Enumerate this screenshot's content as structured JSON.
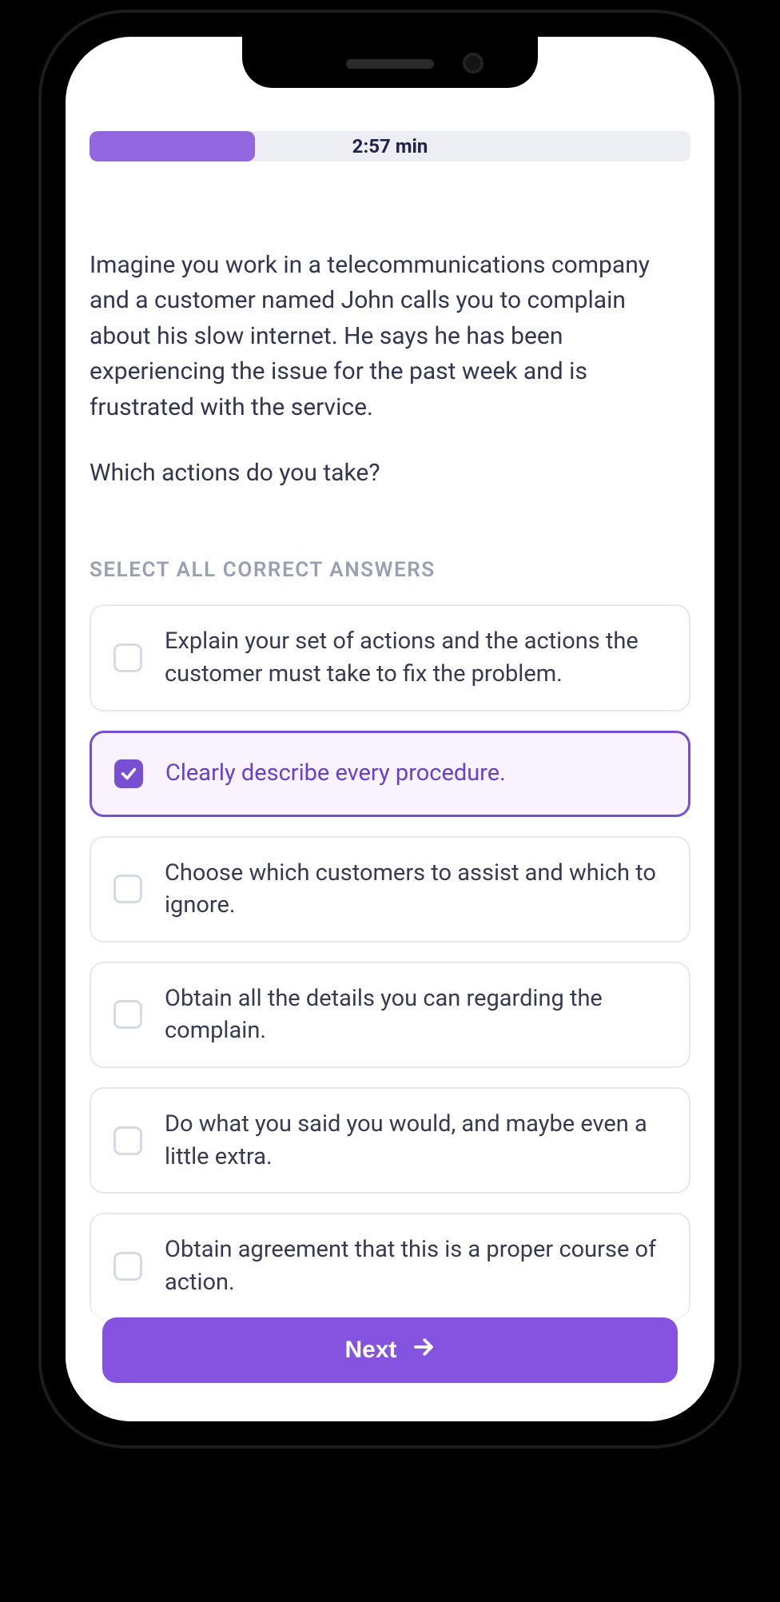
{
  "progress": {
    "percent": 27.5,
    "timer_label": "2:57 min"
  },
  "question": {
    "scenario": "Imagine you work in a telecommunications company and a customer named John calls you to complain about his slow internet. He says he has been experiencing the issue for the past week and is frustrated with the service.",
    "prompt": "Which actions do you take?"
  },
  "instructions": "SELECT ALL CORRECT ANSWERS",
  "options": [
    {
      "text": "Explain your set of actions and the actions the customer must take to fix the problem.",
      "selected": false
    },
    {
      "text": "Clearly describe every procedure.",
      "selected": true
    },
    {
      "text": "Choose which customers to assist and which to ignore.",
      "selected": false
    },
    {
      "text": "Obtain all the details you can regarding the complain.",
      "selected": false
    },
    {
      "text": "Do what you said you would, and maybe even a little extra.",
      "selected": false
    },
    {
      "text": "Obtain agreement that this is a proper course of action.",
      "selected": false
    }
  ],
  "footer": {
    "next_label": "Next"
  },
  "colors": {
    "accent": "#8454e0",
    "accent_light": "#9367e0",
    "text": "#32374f",
    "muted": "#97a1b3",
    "border": "#e6e8ef"
  }
}
